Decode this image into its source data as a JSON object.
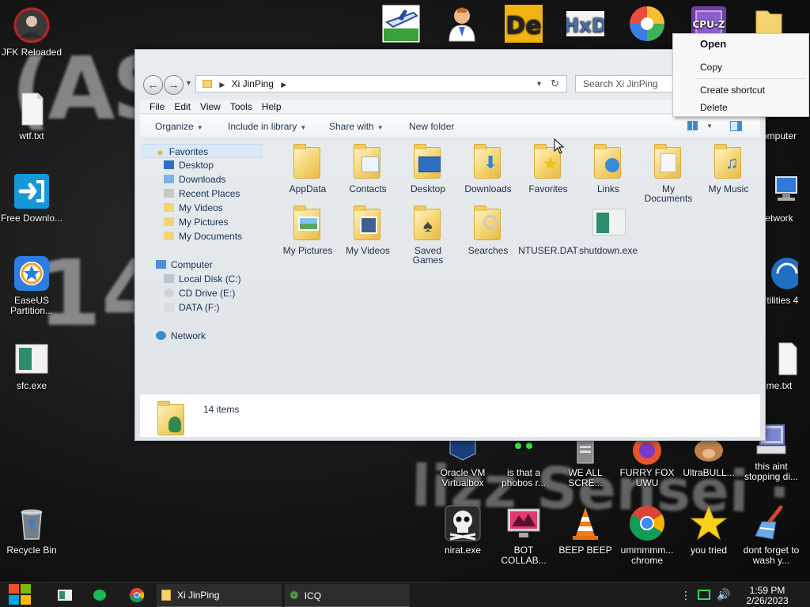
{
  "desktop": {
    "left_icons": [
      {
        "label": "JFK Reloaded",
        "icon": "portrait-icon"
      },
      {
        "label": "wtf.txt",
        "icon": "text-file-icon"
      },
      {
        "label": "Free Downlo...",
        "icon": "download-arrow-icon"
      },
      {
        "label": "EaseUS Partition...",
        "icon": "easeus-star-icon"
      },
      {
        "label": "sfc.exe",
        "icon": "exe-window-icon"
      },
      {
        "label": "Recycle Bin",
        "icon": "recycle-bin-icon"
      }
    ],
    "top_icons": [
      {
        "icon": "plane-game-icon"
      },
      {
        "icon": "doctor-icon"
      },
      {
        "icon": "de-logo-icon"
      },
      {
        "icon": "hxd-icon"
      },
      {
        "icon": "colorful-swirl-icon"
      },
      {
        "icon": "cpu-z-icon"
      }
    ],
    "right_icons": [
      {
        "label": "omputer",
        "icon": "computer-icon"
      },
      {
        "label": "etwork",
        "icon": "network-icon"
      },
      {
        "label": "Utilities\n4",
        "icon": "utilities-icon"
      },
      {
        "label": "me.txt",
        "icon": "text-file-icon"
      },
      {
        "label": "this aint stopping di...",
        "icon": "computer-disk-icon"
      },
      {
        "label": "dont forget to wash y...",
        "icon": "broom-icon"
      }
    ],
    "bottom_icons": [
      {
        "label": "Oracle VM Virtualbox",
        "icon": "virtualbox-icon"
      },
      {
        "label": "is that a phobos r...",
        "icon": "alien-icon"
      },
      {
        "label": "WE ALL SCRE...",
        "icon": "server-icon"
      },
      {
        "label": "FURRY FOX UWU",
        "icon": "firefox-icon"
      },
      {
        "label": "UltraBULL...",
        "icon": "bull-icon"
      },
      {
        "label": "nirat.exe",
        "icon": "skull-icon"
      },
      {
        "label": "BOT COLLAB...",
        "icon": "monitor-icon"
      },
      {
        "label": "BEEP BEEP",
        "icon": "traffic-cone-icon"
      },
      {
        "label": "ummmmm... chrome",
        "icon": "chrome-icon"
      },
      {
        "label": "you tried",
        "icon": "gold-star-icon"
      }
    ]
  },
  "explorer": {
    "address_path": "Xi JinPing",
    "search_placeholder": "Search Xi JinPing",
    "menu": [
      "File",
      "Edit",
      "View",
      "Tools",
      "Help"
    ],
    "commands": {
      "organize": "Organize",
      "include": "Include in library",
      "share": "Share with",
      "new_folder": "New folder"
    },
    "nav": {
      "favorites": "Favorites",
      "desktop": "Desktop",
      "downloads": "Downloads",
      "recent": "Recent Places",
      "videos": "My Videos",
      "pictures": "My Pictures",
      "documents": "My Documents",
      "computer": "Computer",
      "local_disk": "Local Disk (C:)",
      "cd_drive": "CD Drive (E:)",
      "data_drive": "DATA (F:)",
      "network": "Network"
    },
    "items": [
      {
        "label": "AppData",
        "type": "folder"
      },
      {
        "label": "Contacts",
        "type": "folder-contacts"
      },
      {
        "label": "Desktop",
        "type": "folder-desktop"
      },
      {
        "label": "Downloads",
        "type": "folder-downloads"
      },
      {
        "label": "Favorites",
        "type": "folder-favorites"
      },
      {
        "label": "Links",
        "type": "folder-links"
      },
      {
        "label": "My Documents",
        "type": "folder-documents"
      },
      {
        "label": "My Music",
        "type": "folder-music"
      },
      {
        "label": "My Pictures",
        "type": "folder-pictures"
      },
      {
        "label": "My Videos",
        "type": "folder-videos"
      },
      {
        "label": "Saved Games",
        "type": "folder-games"
      },
      {
        "label": "Searches",
        "type": "folder-searches"
      },
      {
        "label": "NTUSER.DAT",
        "type": "file"
      },
      {
        "label": "shutdown.exe",
        "type": "exe"
      }
    ],
    "status_count": "14 items"
  },
  "context_menu": {
    "open": "Open",
    "copy": "Copy",
    "create_shortcut": "Create shortcut",
    "delete": "Delete"
  },
  "taskbar": {
    "tasks": [
      {
        "label": "Xi JinPing",
        "icon": "folder-icon"
      },
      {
        "label": "ICQ",
        "icon": "icq-flower-icon"
      }
    ],
    "time": "1:59 PM",
    "date": "2/26/2023"
  },
  "colors": {
    "accent_blue": "#1e3552",
    "folder_yellow": "#f4d470",
    "taskbar": "#1c1c1c"
  }
}
